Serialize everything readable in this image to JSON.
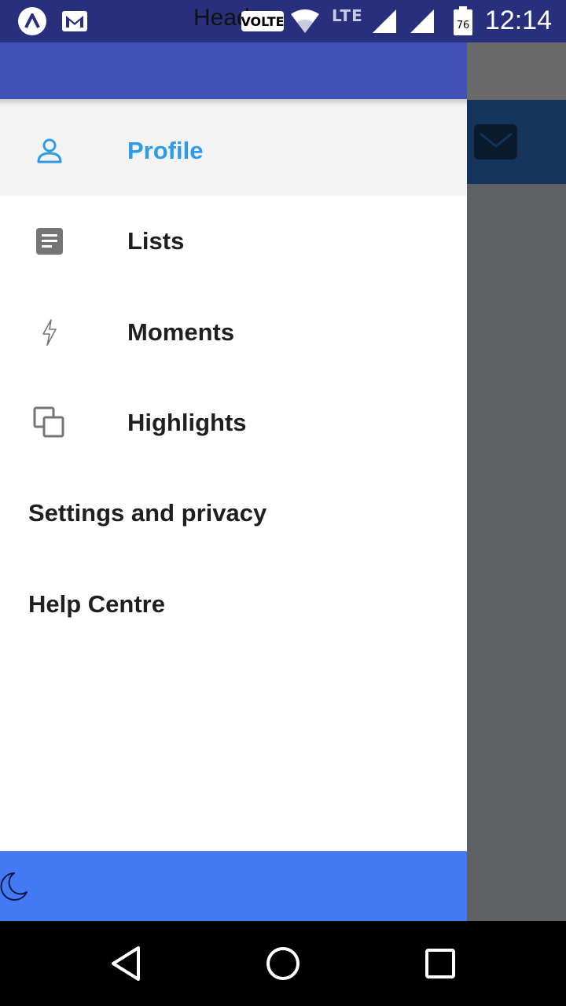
{
  "status_bar": {
    "header_text": "Head",
    "volte_label": "VOLTE",
    "lte_label": "LTE",
    "battery_level": "76",
    "time": "12:14",
    "icons": [
      "app-a-icon",
      "gmail-icon",
      "wifi-icon",
      "signal-icon",
      "signal-icon",
      "battery-icon"
    ]
  },
  "drawer": {
    "menu_items": [
      {
        "label": "Profile",
        "icon": "profile-icon",
        "selected": true
      },
      {
        "label": "Lists",
        "icon": "lists-icon",
        "selected": false
      },
      {
        "label": "Moments",
        "icon": "lightning-icon",
        "selected": false
      },
      {
        "label": "Highlights",
        "icon": "highlights-icon",
        "selected": false
      }
    ],
    "secondary_items": [
      {
        "label": "Settings and privacy"
      },
      {
        "label": "Help Centre"
      }
    ],
    "footer": {
      "icon": "moon-icon"
    }
  },
  "nav_bar": {
    "icons": [
      "back-icon",
      "home-icon",
      "recents-icon"
    ]
  },
  "colors": {
    "status_bar": "#28307e",
    "drawer_header": "#4050b5",
    "selected_text": "#2f9be8",
    "footer": "#4479f4",
    "scrim": "#5f6062"
  }
}
